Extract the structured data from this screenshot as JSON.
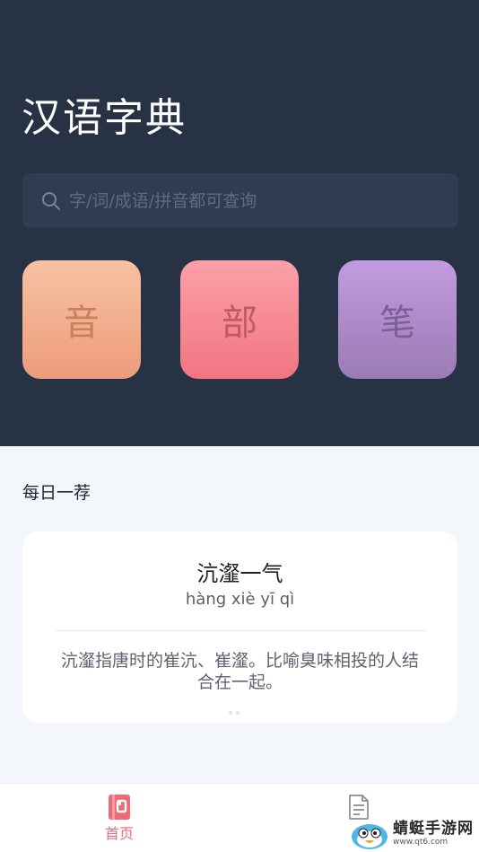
{
  "header": {
    "title": "汉语字典"
  },
  "search": {
    "placeholder": "字/词/成语/拼音都可查询",
    "icon": "search-icon"
  },
  "lookup_tiles": [
    {
      "label": "音",
      "color": "#ee9c7a"
    },
    {
      "label": "部",
      "color": "#f17581"
    },
    {
      "label": "笔",
      "color": "#9a7bb4"
    }
  ],
  "daily": {
    "section_title": "每日一荐",
    "idiom": "沆瀣一气",
    "pinyin": "hàng xiè yī qì",
    "meaning": "沆瀣指唐时的崔沆、崔瀣。比喻臭味相投的人结合在一起。"
  },
  "tabbar": {
    "tabs": [
      {
        "label": "首页",
        "icon": "home-book-icon",
        "active": true,
        "color": "#ee6a76"
      },
      {
        "label": "",
        "icon": "document-icon",
        "active": false
      }
    ]
  },
  "watermark": {
    "name": "蜻蜓手游网",
    "url": "www.qt6.com"
  }
}
